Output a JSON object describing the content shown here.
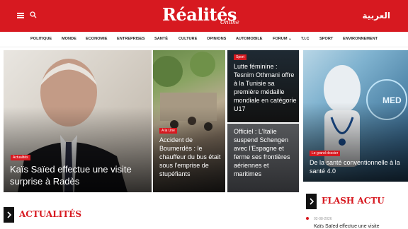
{
  "header": {
    "logo_main": "Réalités",
    "logo_sub": "Online",
    "language_link": "العربية",
    "brand_color": "#d71920",
    "menu_icon": "hamburger-icon",
    "search_icon": "search-icon"
  },
  "nav": {
    "items": [
      {
        "label": "POLITIQUE"
      },
      {
        "label": "MONDE"
      },
      {
        "label": "ECONOMIE"
      },
      {
        "label": "ENTREPRISES"
      },
      {
        "label": "SANTÉ"
      },
      {
        "label": "CULTURE"
      },
      {
        "label": "OPINIONS"
      },
      {
        "label": "AUTOMOBILE"
      },
      {
        "label": "FORUM"
      },
      {
        "label": "T.I.C"
      },
      {
        "label": "SPORT"
      },
      {
        "label": "ENVIRONNEMENT"
      }
    ]
  },
  "featured": [
    {
      "tag": "Actualités",
      "title": "Kaïs Saïed effectue une visite surprise à Radès"
    },
    {
      "tag": "A la Une",
      "title": "Accident de Boumerdès : le chauffeur du bus était sous l'emprise de stupéfiants"
    },
    {
      "tag": "Sport",
      "title": "Lutte féminine : Tesnim Othmani offre à la Tunisie sa première médaille mondiale en catégorie U17"
    },
    {
      "tag": "",
      "title": "Officiel : L'Italie suspend Schengen avec l'Espagne et ferme ses frontières aériennes et maritimes"
    },
    {
      "tag": "Le grand dossier",
      "title": "De la santé conventionnelle à la santé 4.0"
    }
  ],
  "sections": {
    "actualites_title": "ACTUALITÉS",
    "flash_title": "FLASH ACTU"
  },
  "flash": {
    "date": "02-08-2026",
    "text": "Kaïs Saïed effectue une visite"
  }
}
